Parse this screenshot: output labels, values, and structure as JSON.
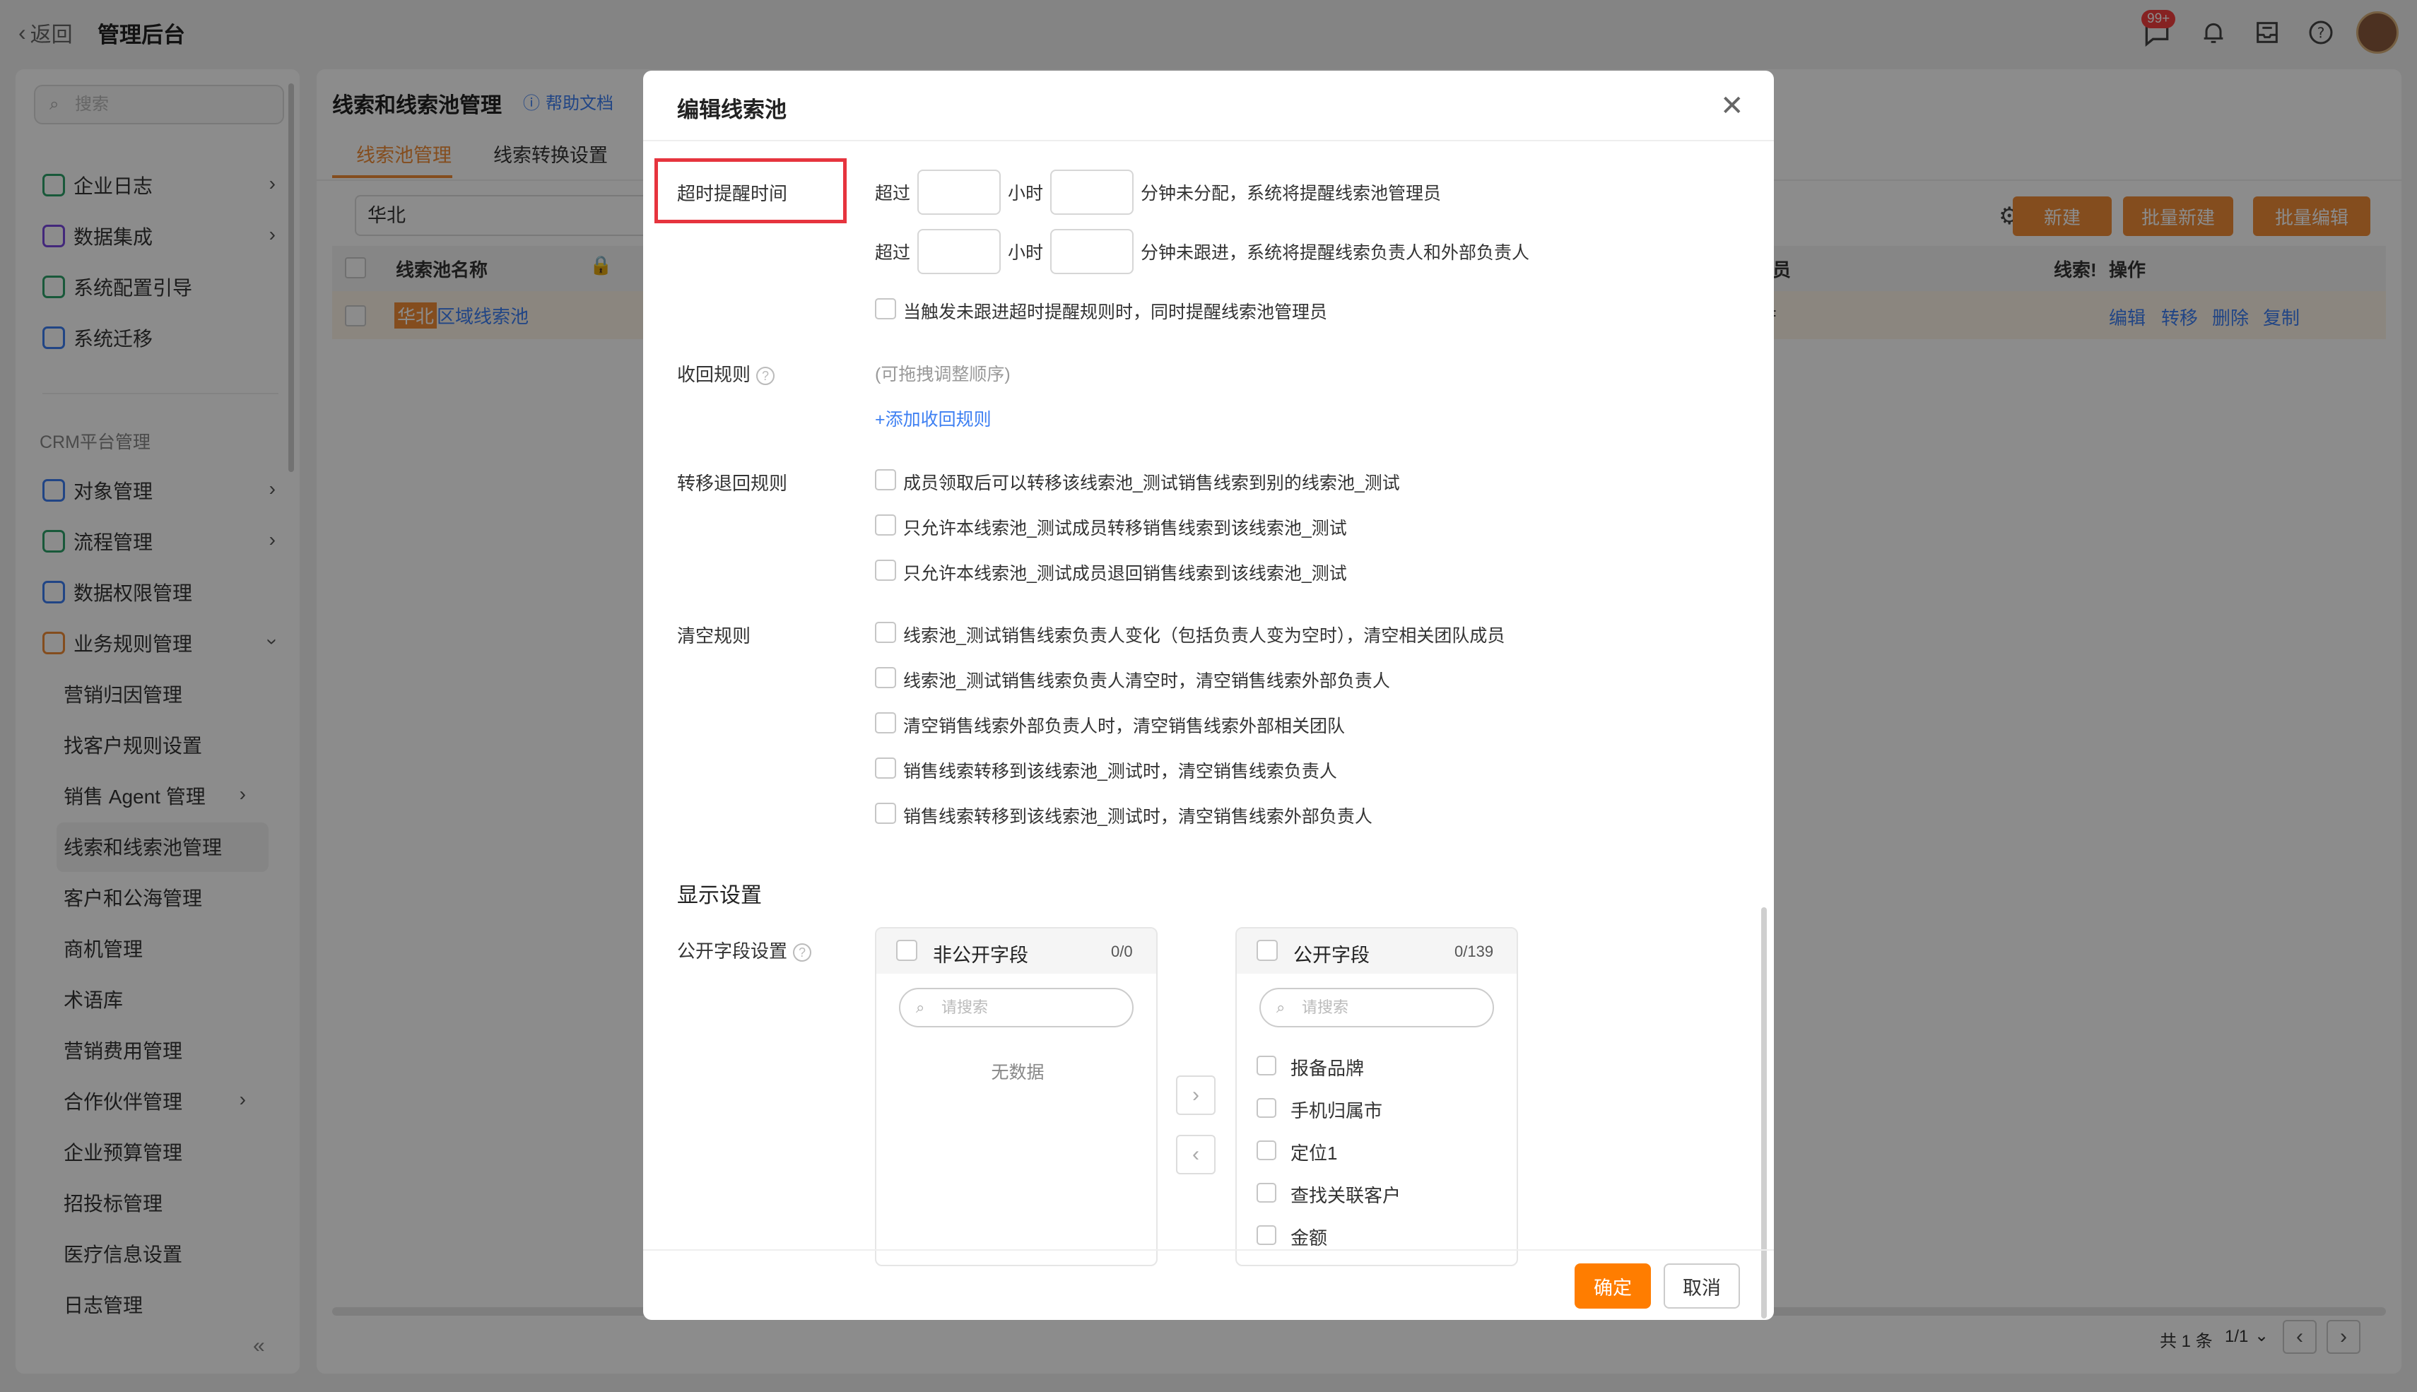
{
  "topbar": {
    "back_label": "返回",
    "app_title": "管理后台",
    "notification_badge": "99+",
    "icons": [
      "chat-icon",
      "bell-icon",
      "inbox-icon",
      "help-icon",
      "avatar"
    ]
  },
  "sidebar": {
    "search_placeholder": "搜索",
    "items_top": [
      {
        "label": "企业日志",
        "icon": "log-icon",
        "expandable": true
      },
      {
        "label": "数据集成",
        "icon": "integration-icon",
        "expandable": true
      },
      {
        "label": "系统配置引导",
        "icon": "guide-icon",
        "expandable": false
      },
      {
        "label": "系统迁移",
        "icon": "migration-icon",
        "expandable": false
      }
    ],
    "section_title": "CRM平台管理",
    "items_crm": [
      {
        "label": "对象管理",
        "icon": "object-icon",
        "expandable": true
      },
      {
        "label": "流程管理",
        "icon": "flow-icon",
        "expandable": true
      },
      {
        "label": "数据权限管理",
        "icon": "permission-icon",
        "expandable": false
      },
      {
        "label": "业务规则管理",
        "icon": "rule-icon",
        "expandable": true,
        "expanded": true
      }
    ],
    "sub_items": [
      {
        "label": "营销归因管理",
        "expandable": false
      },
      {
        "label": "找客户规则设置",
        "expandable": false
      },
      {
        "label": "销售 Agent 管理",
        "expandable": true
      },
      {
        "label": "线索和线索池管理",
        "expandable": false,
        "active": true
      },
      {
        "label": "客户和公海管理",
        "expandable": false
      },
      {
        "label": "商机管理",
        "expandable": false
      },
      {
        "label": "术语库",
        "expandable": false
      },
      {
        "label": "营销费用管理",
        "expandable": false
      },
      {
        "label": "合作伙伴管理",
        "expandable": true
      },
      {
        "label": "企业预算管理",
        "expandable": false
      },
      {
        "label": "招投标管理",
        "expandable": false
      },
      {
        "label": "医疗信息设置",
        "expandable": false
      },
      {
        "label": "日志管理",
        "expandable": false
      }
    ],
    "collapse_label": "«"
  },
  "main": {
    "page_title": "线索和线索池管理",
    "help_doc": "帮助文档",
    "tabs": [
      {
        "label": "线索池管理",
        "active": true
      },
      {
        "label": "线索转换设置",
        "active": false
      }
    ],
    "filter_value": "华北",
    "buttons": {
      "new": "新建",
      "batch_new": "批量新建",
      "batch_edit": "批量编辑"
    },
    "table": {
      "col_name": "线索池名称",
      "col_admin_partial": "理员",
      "col_lead_partial": "线索!",
      "col_ops": "操作",
      "row": {
        "name_highlight": "华北",
        "name_rest": "区域线索池",
        "admin_partial": "芳",
        "ops": [
          "编辑",
          "转移",
          "删除",
          "复制"
        ]
      }
    },
    "pagination": {
      "total": "共 1 条",
      "page": "1/1"
    }
  },
  "modal": {
    "title": "编辑线索池",
    "timeout": {
      "label": "超时提醒时间",
      "row1": {
        "prefix": "超过",
        "hours": "小时",
        "suffix": "分钟未分配，系统将提醒线索池管理员",
        "hour_value": "",
        "minute_value": ""
      },
      "row2": {
        "prefix": "超过",
        "hours": "小时",
        "suffix": "分钟未跟进，系统将提醒线索负责人和外部负责人",
        "hour_value": "",
        "minute_value": ""
      },
      "also_notify": "当触发未跟进超时提醒规则时，同时提醒线索池管理员"
    },
    "recycle": {
      "label": "收回规则",
      "hint": "(可拖拽调整顺序)",
      "add_link": "+添加收回规则"
    },
    "transfer_rules": {
      "label": "转移退回规则",
      "options": [
        "成员领取后可以转移该线索池_测试销售线索到别的线索池_测试",
        "只允许本线索池_测试成员转移销售线索到该线索池_测试",
        "只允许本线索池_测试成员退回销售线索到该线索池_测试"
      ]
    },
    "clear_rules": {
      "label": "清空规则",
      "options": [
        "线索池_测试销售线索负责人变化（包括负责人变为空时），清空相关团队成员",
        "线索池_测试销售线索负责人清空时，清空销售线索外部负责人",
        "清空销售线索外部负责人时，清空销售线索外部相关团队",
        "销售线索转移到该线索池_测试时，清空销售线索负责人",
        "销售线索转移到该线索池_测试时，清空销售线索外部负责人"
      ]
    },
    "display": {
      "section_title": "显示设置",
      "public_fields_label": "公开字段设置",
      "left_panel": {
        "title": "非公开字段",
        "count": "0/0",
        "search_placeholder": "请搜索",
        "empty": "无数据"
      },
      "right_panel": {
        "title": "公开字段",
        "count": "0/139",
        "search_placeholder": "请搜索",
        "items": [
          "报备品牌",
          "手机归属市",
          "定位1",
          "查找关联客户",
          "金额"
        ]
      }
    },
    "footer": {
      "ok": "确定",
      "cancel": "取消"
    }
  }
}
